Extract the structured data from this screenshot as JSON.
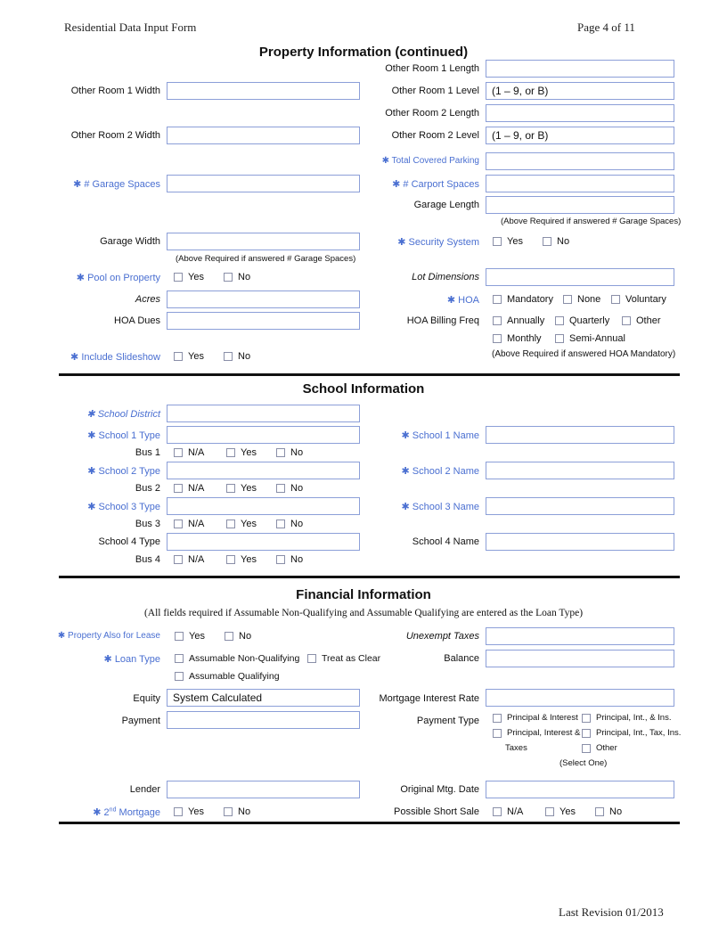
{
  "header": {
    "form_title": "Residential Data Input Form",
    "page": "Page 4 of 11"
  },
  "footer": {
    "revision": "Last Revision 01/2013"
  },
  "colors": {
    "required_label": "#4a6fd1",
    "field_border": "#8c9fd8",
    "rule": "#111111"
  },
  "required_marker": "✱",
  "property": {
    "title": "Property Information (continued)",
    "other_room1_length": {
      "label": "Other Room 1 Length",
      "value": ""
    },
    "other_room1_width": {
      "label": "Other Room 1 Width",
      "value": ""
    },
    "other_room1_level": {
      "label": "Other Room 1 Level",
      "value": "(1 – 9, or B)"
    },
    "other_room2_length": {
      "label": "Other Room 2 Length",
      "value": ""
    },
    "other_room2_width": {
      "label": "Other Room 2 Width",
      "value": ""
    },
    "other_room2_level": {
      "label": "Other Room 2 Level",
      "value": "(1 – 9, or B)"
    },
    "total_covered_parking": {
      "label": "Total Covered Parking",
      "value": ""
    },
    "garage_spaces": {
      "label": "# Garage Spaces",
      "value": ""
    },
    "carport_spaces": {
      "label": "# Carport Spaces",
      "value": ""
    },
    "garage_length": {
      "label": "Garage Length",
      "value": "",
      "note": "(Above Required if answered #  Garage Spaces)"
    },
    "garage_width": {
      "label": "Garage Width",
      "value": "",
      "note": "(Above Required if answered #  Garage Spaces)"
    },
    "security_system": {
      "label": "Security System",
      "options": [
        "Yes",
        "No"
      ]
    },
    "pool": {
      "label": "Pool on Property",
      "options": [
        "Yes",
        "No"
      ]
    },
    "lot_dimensions": {
      "label": "Lot Dimensions",
      "value": ""
    },
    "acres": {
      "label": "Acres",
      "value": ""
    },
    "hoa": {
      "label": "HOA",
      "options": [
        "Mandatory",
        "None",
        "Voluntary"
      ]
    },
    "hoa_dues": {
      "label": "HOA Dues",
      "value": ""
    },
    "hoa_billing": {
      "label": "HOA Billing Freq",
      "options": [
        "Annually",
        "Quarterly",
        "Other",
        "Monthly",
        "Semi-Annual"
      ],
      "note": "(Above Required if answered HOA Mandatory)"
    },
    "slideshow": {
      "label": "Include Slideshow",
      "options": [
        "Yes",
        "No"
      ]
    }
  },
  "school": {
    "title": "School Information",
    "district": {
      "label": "School District",
      "value": ""
    },
    "bus_options": [
      "N/A",
      "Yes",
      "No"
    ],
    "rows": [
      {
        "type_label": "School 1 Type",
        "name_label": "School 1 Name",
        "bus_label": "Bus 1"
      },
      {
        "type_label": "School 2 Type",
        "name_label": "School 2 Name",
        "bus_label": "Bus 2"
      },
      {
        "type_label": "School 3 Type",
        "name_label": "School 3 Name",
        "bus_label": "Bus 3"
      },
      {
        "type_label": "School 4 Type",
        "name_label": "School 4 Name",
        "bus_label": "Bus 4"
      }
    ]
  },
  "financial": {
    "title": "Financial Information",
    "subtitle": "(All fields required if Assumable Non-Qualifying and Assumable Qualifying are entered as the Loan Type)",
    "lease": {
      "label": "Property Also for Lease",
      "options": [
        "Yes",
        "No"
      ]
    },
    "unexempt_taxes": {
      "label": "Unexempt Taxes",
      "value": ""
    },
    "loan_type": {
      "label": "Loan Type",
      "options": [
        "Assumable Non-Qualifying",
        "Treat as Clear",
        "Assumable Qualifying"
      ]
    },
    "balance": {
      "label": "Balance",
      "value": ""
    },
    "equity": {
      "label": "Equity",
      "value": "System Calculated"
    },
    "mortgage_rate": {
      "label": "Mortgage Interest Rate",
      "value": ""
    },
    "payment": {
      "label": "Payment",
      "value": ""
    },
    "payment_type": {
      "label": "Payment Type",
      "options": [
        "Principal & Interest",
        "Principal, Int., & Ins.",
        "Principal, Interest &",
        "Principal, Int., Tax, Ins.",
        "Other"
      ],
      "wrap": "Taxes",
      "note": "(Select One)"
    },
    "lender": {
      "label": "Lender",
      "value": ""
    },
    "original_date": {
      "label": "Original Mtg. Date",
      "value": ""
    },
    "second_mortgage": {
      "label_pre": "2",
      "label_sup": "nd",
      "label_post": " Mortgage",
      "options": [
        "Yes",
        "No"
      ]
    },
    "short_sale": {
      "label": "Possible Short Sale",
      "options": [
        "N/A",
        "Yes",
        "No"
      ]
    }
  }
}
